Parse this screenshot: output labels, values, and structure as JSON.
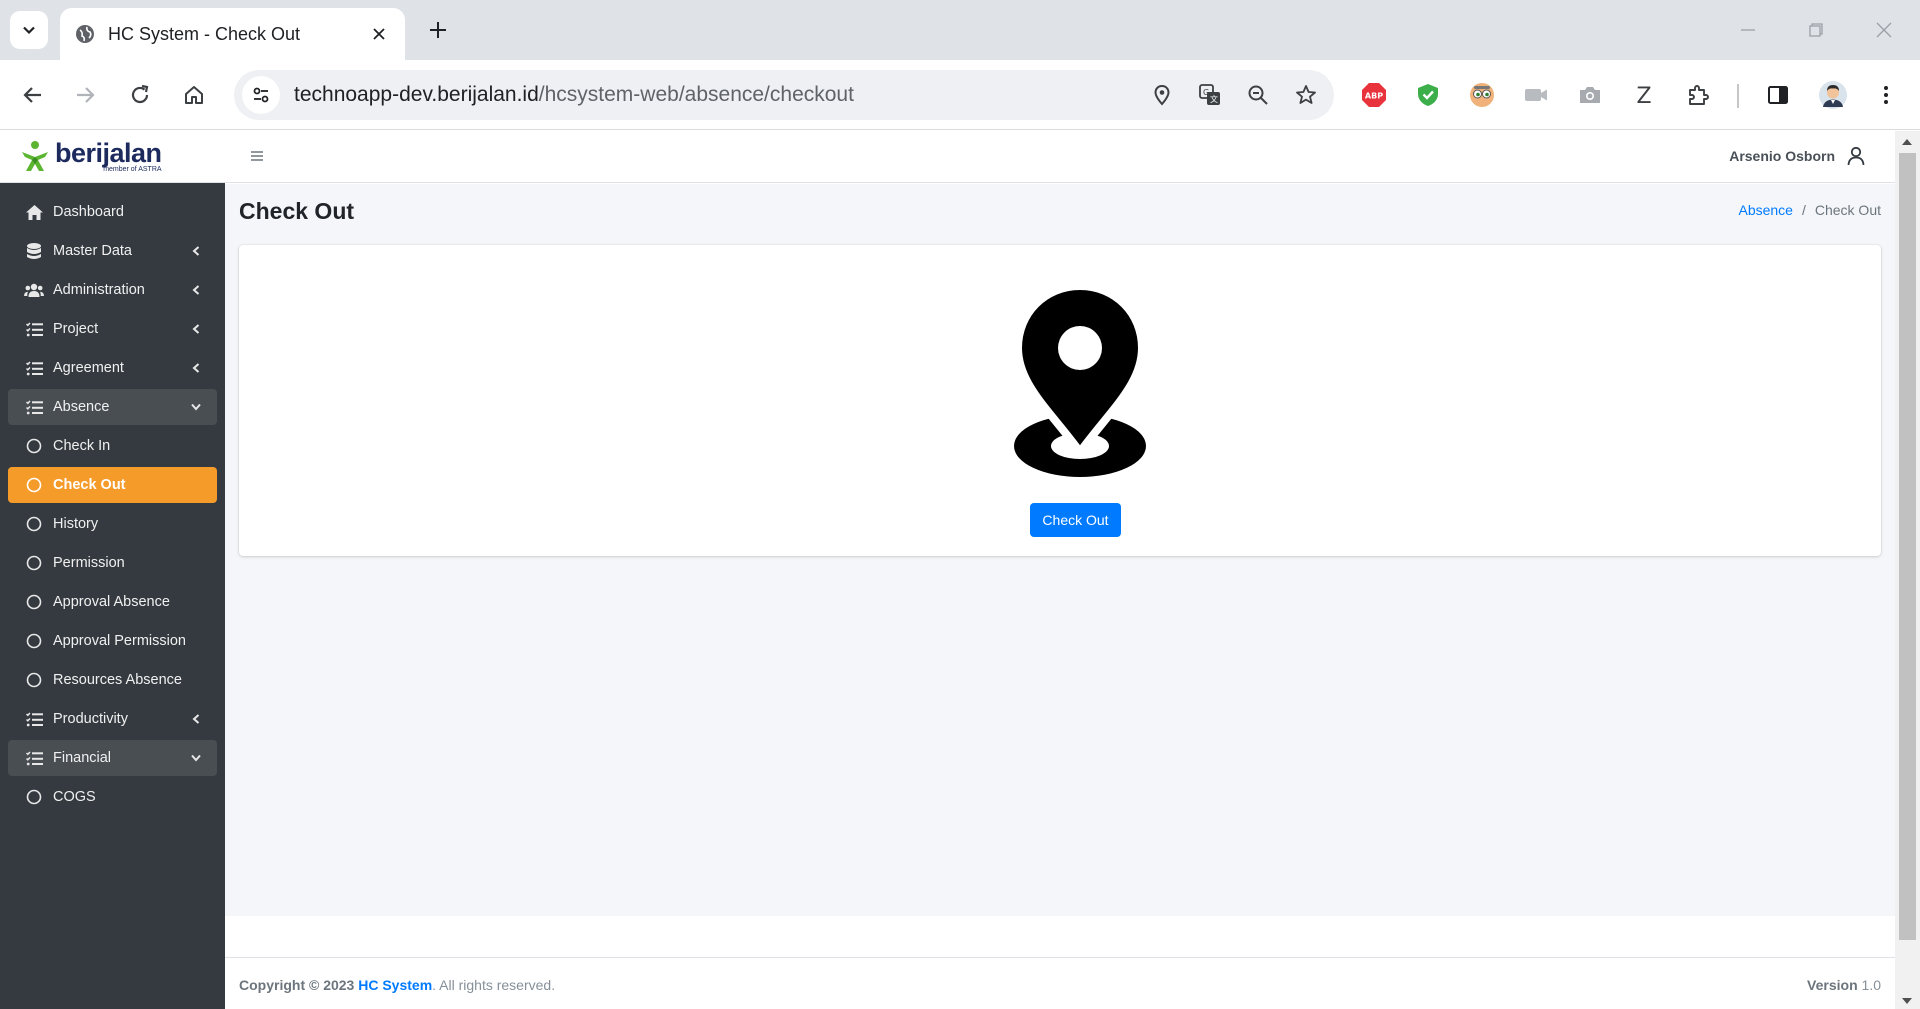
{
  "browser": {
    "tab_title": "HC System - Check Out",
    "url_host": "technoapp-dev.berijalan.id",
    "url_path": "/hcsystem-web/absence/checkout",
    "extensions": [
      "adblock-plus-icon",
      "shield-extension-icon",
      "eyes-extension-icon",
      "video-extension-icon",
      "camera-extension-icon",
      "z-extension-icon",
      "puzzle-icon"
    ],
    "abp_label": "ABP",
    "z_label": "Z"
  },
  "brand": {
    "name": "berijalan",
    "sub": "member of ASTRA",
    "color": "#1d2a5d",
    "logo_color": "#5cb531"
  },
  "sidebar": {
    "items": [
      {
        "label": "Dashboard",
        "icon": "home-icon"
      },
      {
        "label": "Master Data",
        "icon": "database-icon"
      },
      {
        "label": "Administration",
        "icon": "users-icon"
      },
      {
        "label": "Project",
        "icon": "tasks-icon"
      },
      {
        "label": "Agreement",
        "icon": "tasks-icon"
      },
      {
        "label": "Absence",
        "icon": "tasks-icon"
      },
      {
        "label": "Check In",
        "icon": "circle-icon"
      },
      {
        "label": "Check Out",
        "icon": "circle-icon"
      },
      {
        "label": "History",
        "icon": "circle-icon"
      },
      {
        "label": "Permission",
        "icon": "circle-icon"
      },
      {
        "label": "Approval Absence",
        "icon": "circle-icon"
      },
      {
        "label": "Approval Permission",
        "icon": "circle-icon"
      },
      {
        "label": "Resources Absence",
        "icon": "circle-icon"
      },
      {
        "label": "Productivity",
        "icon": "tasks-icon"
      },
      {
        "label": "Financial",
        "icon": "tasks-icon"
      },
      {
        "label": "COGS",
        "icon": "circle-icon"
      }
    ],
    "active_color": "#f59b2a",
    "background": "#343a40"
  },
  "header": {
    "user_name": "Arsenio Osborn"
  },
  "page": {
    "title": "Check Out",
    "breadcrumb_parent": "Absence",
    "breadcrumb_current": "Check Out",
    "button_label": "Check Out",
    "button_color": "#007bff"
  },
  "footer": {
    "copyright": "Copyright © 2023",
    "brand": "HC System",
    "rights": ". All rights reserved.",
    "version_label": "Version",
    "version_value": "1.0"
  }
}
